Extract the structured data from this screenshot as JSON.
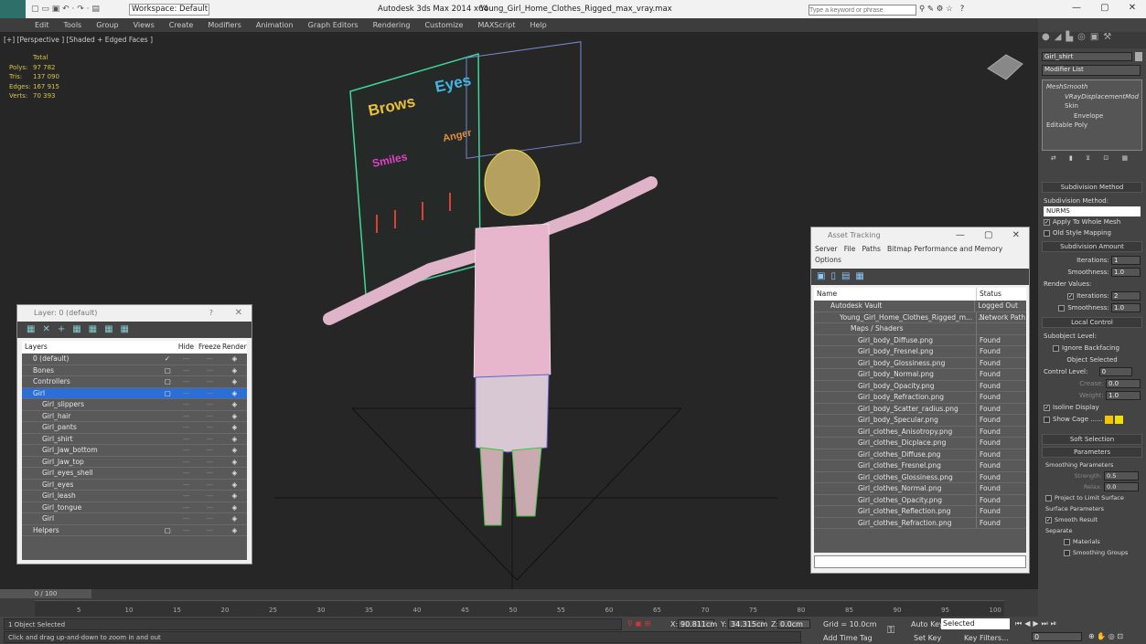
{
  "titlebar": {
    "workspace": "Workspace: Default",
    "app": "Autodesk 3ds Max  2014 x64",
    "file": "Young_Girl_Home_Clothes_Rigged_max_vray.max",
    "search_placeholder": "Type a keyword or phrase"
  },
  "menu": [
    "Edit",
    "Tools",
    "Group",
    "Views",
    "Create",
    "Modifiers",
    "Animation",
    "Graph Editors",
    "Rendering",
    "Customize",
    "MAXScript",
    "Help"
  ],
  "viewport": {
    "label": "[+] [Perspective ] [Shaded + Edged Faces ]",
    "stats": {
      "header": "Total",
      "rows": [
        [
          "Polys:",
          "97 782"
        ],
        [
          "Tris:",
          "137 090"
        ],
        [
          "Edges:",
          "167 915"
        ],
        [
          "Verts:",
          "70 393"
        ]
      ]
    },
    "board": {
      "brows": "Brows",
      "eyes": "Eyes",
      "smiles": "Smiles",
      "anger": "Anger"
    }
  },
  "command_panel": {
    "object_name": "Girl_shirt",
    "modifier_list": "Modifier List",
    "stack": [
      "MeshSmooth",
      "VRayDisplacementMod",
      "Skin",
      "Envelope",
      "Editable Poly"
    ],
    "subdivision_method": {
      "title": "Subdivision Method",
      "label": "Subdivision Method:",
      "value": "NURMS",
      "apply": "Apply To Whole Mesh",
      "old": "Old Style Mapping"
    },
    "subdivision_amount": {
      "title": "Subdivision Amount",
      "iterations_label": "Iterations:",
      "iterations": "1",
      "smoothness_label": "Smoothness:",
      "smoothness": "1.0",
      "render_values": "Render Values:",
      "r_iterations": "2",
      "r_smoothness": "1.0"
    },
    "local_control": {
      "title": "Local Control",
      "subobject": "Subobject Level:",
      "ignore": "Ignore Backfacing",
      "selected": "Object Selected",
      "control_label": "Control Level:",
      "control": "0",
      "crease_label": "Crease:",
      "crease": "0.0",
      "weight_label": "Weight:",
      "weight": "1.0",
      "isoline": "Isoline Display",
      "cage": "Show Cage ......"
    },
    "soft_selection": "Soft Selection",
    "parameters": {
      "title": "Parameters",
      "smoothing": "Smoothing Parameters",
      "strength_label": "Strength:",
      "strength": "0.5",
      "relax_label": "Relax:",
      "relax": "0.0",
      "project": "Project to Limit Surface",
      "surface": "Surface Parameters",
      "smooth_result": "Smooth Result",
      "separate": "Separate",
      "materials": "Materials",
      "groups": "Smoothing Groups"
    },
    "colors": {
      "cage1": "#f5c400",
      "cage2": "#f0e000"
    }
  },
  "asset_tracking": {
    "title": "Asset Tracking",
    "menu": [
      "Server",
      "File",
      "Paths",
      "Bitmap Performance and Memory",
      "Options"
    ],
    "col_name": "Name",
    "col_status": "Status",
    "rows": [
      [
        "Autodesk Vault",
        "Logged Out ..."
      ],
      [
        "Young_Girl_Home_Clothes_Rigged_m...",
        "Network Path"
      ],
      [
        "Maps / Shaders",
        ""
      ],
      [
        "Girl_body_Diffuse.png",
        "Found"
      ],
      [
        "Girl_body_Fresnel.png",
        "Found"
      ],
      [
        "Girl_body_Glossiness.png",
        "Found"
      ],
      [
        "Girl_body_Normal.png",
        "Found"
      ],
      [
        "Girl_body_Opacity.png",
        "Found"
      ],
      [
        "Girl_body_Refraction.png",
        "Found"
      ],
      [
        "Girl_body_Scatter_radius.png",
        "Found"
      ],
      [
        "Girl_body_Specular.png",
        "Found"
      ],
      [
        "Girl_clothes_Anisotropy.png",
        "Found"
      ],
      [
        "Girl_clothes_Dicplace.png",
        "Found"
      ],
      [
        "Girl_clothes_Diffuse.png",
        "Found"
      ],
      [
        "Girl_clothes_Fresnel.png",
        "Found"
      ],
      [
        "Girl_clothes_Glossiness.png",
        "Found"
      ],
      [
        "Girl_clothes_Normal.png",
        "Found"
      ],
      [
        "Girl_clothes_Opacity.png",
        "Found"
      ],
      [
        "Girl_clothes_Reflection.png",
        "Found"
      ],
      [
        "Girl_clothes_Refraction.png",
        "Found"
      ]
    ]
  },
  "layer_window": {
    "title": "Layer: 0 (default)",
    "cols": [
      "Layers",
      "Hide",
      "Freeze",
      "Render"
    ],
    "rows": [
      "0 (default)",
      "Bones",
      "Controllers",
      "Girl",
      "Girl_slippers",
      "Girl_hair",
      "Girl_pants",
      "Girl_shirt",
      "Girl_Jaw_bottom",
      "Girl_Jaw_top",
      "Girl_eyes_shell",
      "Girl_eyes",
      "Girl_leash",
      "Girl_tongue",
      "Girl",
      "Helpers"
    ]
  },
  "timeline": {
    "frame": "0 / 100",
    "ticks": [
      "5",
      "10",
      "15",
      "20",
      "25",
      "30",
      "35",
      "40",
      "45",
      "50",
      "55",
      "60",
      "65",
      "70",
      "75",
      "80",
      "85",
      "90",
      "95",
      "100"
    ]
  },
  "status": {
    "selected": "1 Object Selected",
    "prompt": "Click and drag up-and-down to zoom in and out",
    "x_label": "X:",
    "x": "90.811cm",
    "y_label": "Y:",
    "y": "34.315cm",
    "z_label": "Z:",
    "z": "0.0cm",
    "grid": "Grid = 10.0cm",
    "add_time_tag": "Add Time Tag",
    "auto_key": "Auto Key",
    "set_key": "Set Key",
    "selected_set": "Selected",
    "key_filters": "Key Filters...",
    "frame": "0"
  }
}
